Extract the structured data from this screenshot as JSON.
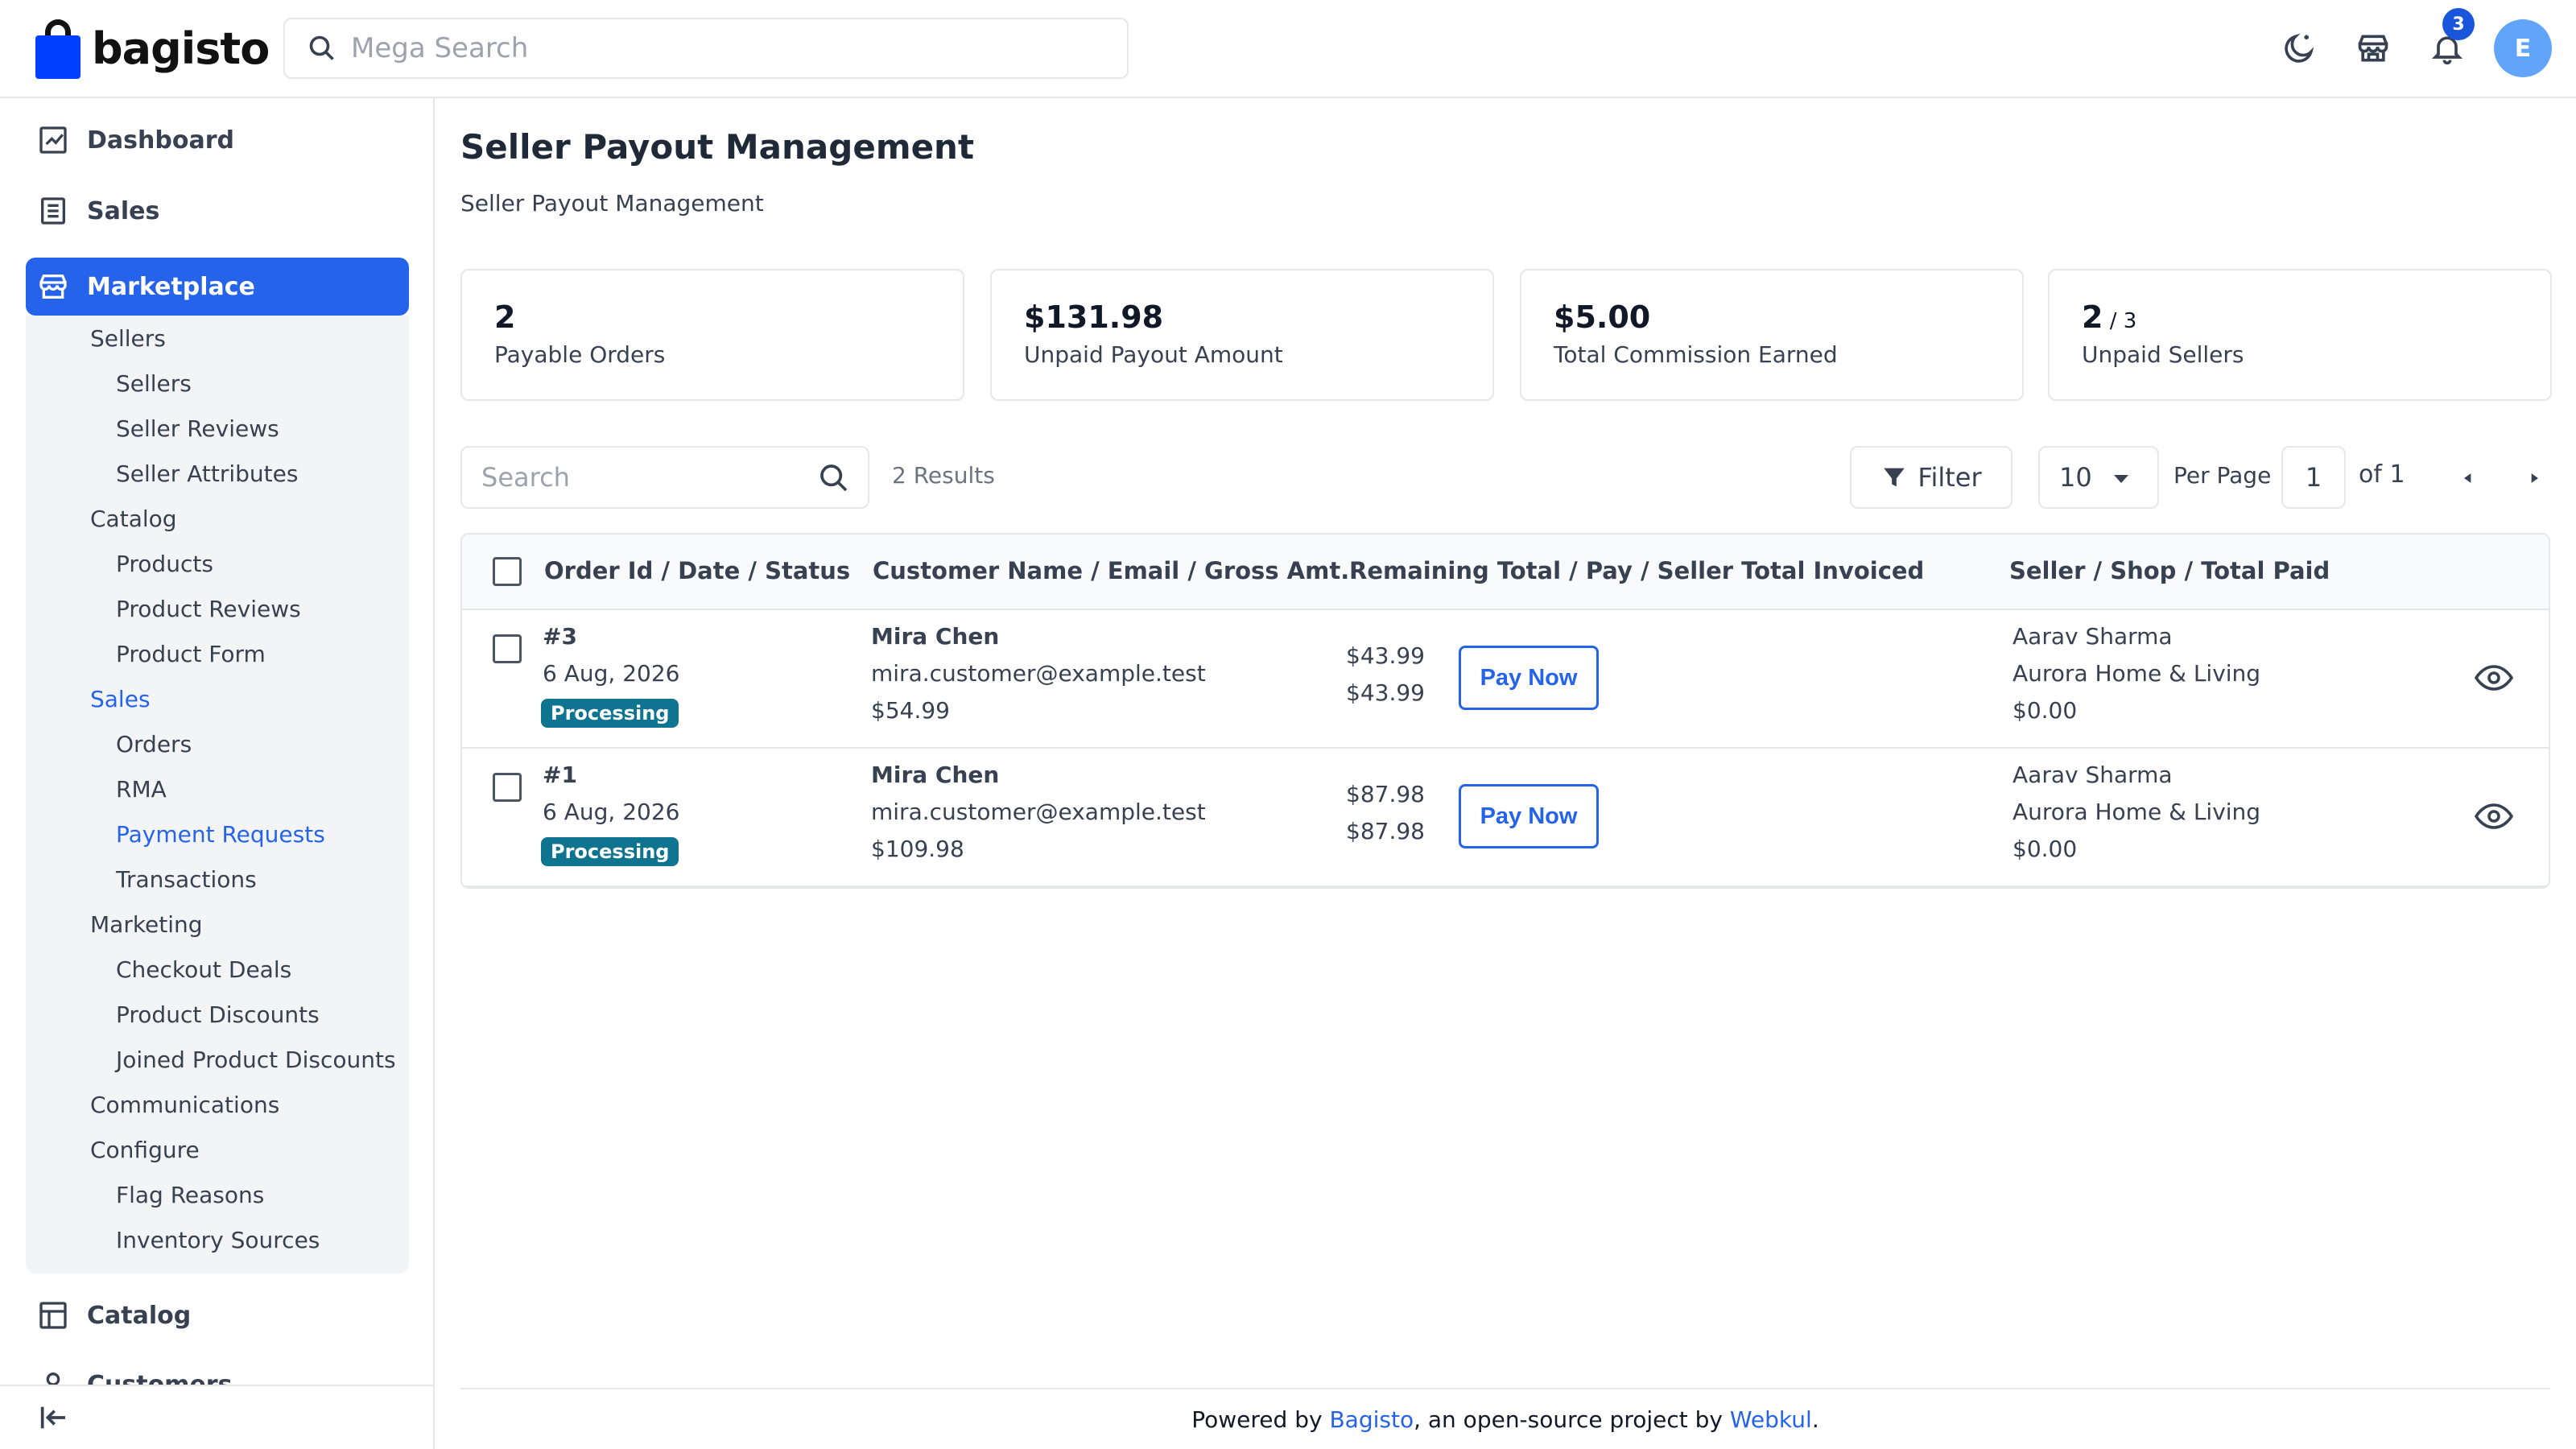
{
  "app": {
    "logo_text": "bagisto"
  },
  "header": {
    "search_placeholder": "Mega Search",
    "notifications_count": "3",
    "avatar_initial": "E"
  },
  "sidebar": {
    "dashboard": "Dashboard",
    "sales": "Sales",
    "marketplace": "Marketplace",
    "catalog": "Catalog",
    "customers": "Customers",
    "sub": {
      "sellers_group": "Sellers",
      "sellers": "Sellers",
      "seller_reviews": "Seller Reviews",
      "seller_attributes": "Seller Attributes",
      "catalog_group": "Catalog",
      "products": "Products",
      "product_reviews": "Product Reviews",
      "product_form": "Product Form",
      "sales_group": "Sales",
      "orders": "Orders",
      "rma": "RMA",
      "payment_requests": "Payment Requests",
      "transactions": "Transactions",
      "marketing_group": "Marketing",
      "checkout_deals": "Checkout Deals",
      "product_discounts": "Product Discounts",
      "joined_product_discounts": "Joined Product Discounts",
      "communications": "Communications",
      "configure_group": "Configure",
      "flag_reasons": "Flag Reasons",
      "inventory_sources": "Inventory Sources"
    }
  },
  "page": {
    "title": "Seller Payout Management",
    "subtitle": "Seller Payout Management"
  },
  "stats": [
    {
      "value": "2",
      "suffix": "",
      "caption": "Payable Orders"
    },
    {
      "value": "$131.98",
      "suffix": "",
      "caption": "Unpaid Payout Amount"
    },
    {
      "value": "$5.00",
      "suffix": "",
      "caption": "Total Commission Earned"
    },
    {
      "value": "2",
      "suffix": " / 3",
      "caption": "Unpaid Sellers"
    }
  ],
  "toolbar": {
    "search_placeholder": "Search",
    "results": "2 Results",
    "filter": "Filter",
    "per_page_value": "10",
    "per_page_label": "Per Page",
    "page": "1",
    "of_pages": "of 1"
  },
  "table": {
    "headers": {
      "order": "Order Id / Date / Status",
      "customer": "Customer Name / Email / Gross Amt.",
      "remaining": "Remaining Total / Pay / Seller Total Invoiced",
      "seller": "Seller / Shop / Total Paid"
    },
    "pay_label": "Pay Now",
    "rows": [
      {
        "order_id": "#3",
        "date": "6 Aug, 2026",
        "status": "Processing",
        "customer": "Mira Chen",
        "email": "mira.customer@example.test",
        "gross": "$54.99",
        "remaining": "$43.99",
        "invoiced": "$43.99",
        "seller": "Aarav Sharma",
        "shop": "Aurora Home & Living",
        "paid": "$0.00"
      },
      {
        "order_id": "#1",
        "date": "6 Aug, 2026",
        "status": "Processing",
        "customer": "Mira Chen",
        "email": "mira.customer@example.test",
        "gross": "$109.98",
        "remaining": "$87.98",
        "invoiced": "$87.98",
        "seller": "Aarav Sharma",
        "shop": "Aurora Home & Living",
        "paid": "$0.00"
      }
    ]
  },
  "footer": {
    "prefix": "Powered by ",
    "link1": "Bagisto",
    "middle": ", an open-source project by ",
    "link2": "Webkul",
    "suffix": "."
  },
  "colors": {
    "accent": "#2563eb",
    "status": "#0e7490"
  }
}
